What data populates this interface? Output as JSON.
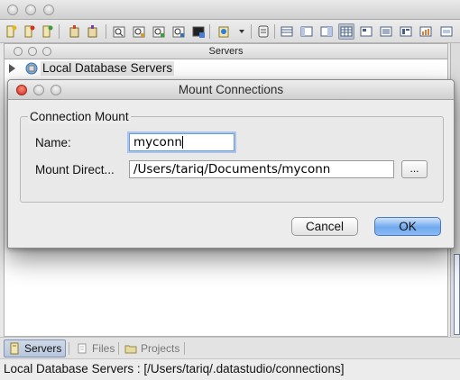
{
  "window": {
    "panel_title": "Servers",
    "tree": {
      "root_label": "Local Database Servers"
    },
    "tabs": [
      {
        "label": "Servers",
        "icon": "server-icon"
      },
      {
        "label": "Files",
        "icon": "files-icon"
      },
      {
        "label": "Projects",
        "icon": "projects-icon"
      }
    ],
    "status_text": "Local Database Servers : [/Users/tariq/.datastudio/connections]"
  },
  "dialog": {
    "title": "Mount Connections",
    "group_title": "Connection Mount",
    "name_label": "Name:",
    "name_value": "myconn",
    "dir_label": "Mount Direct...",
    "dir_value": "/Users/tariq/Documents/myconn",
    "browse_label": "...",
    "cancel_label": "Cancel",
    "ok_label": "OK"
  },
  "colors": {
    "accent": "#6fa8ef",
    "close": "#d12b1b",
    "active_tab": "#b8c7dd"
  }
}
